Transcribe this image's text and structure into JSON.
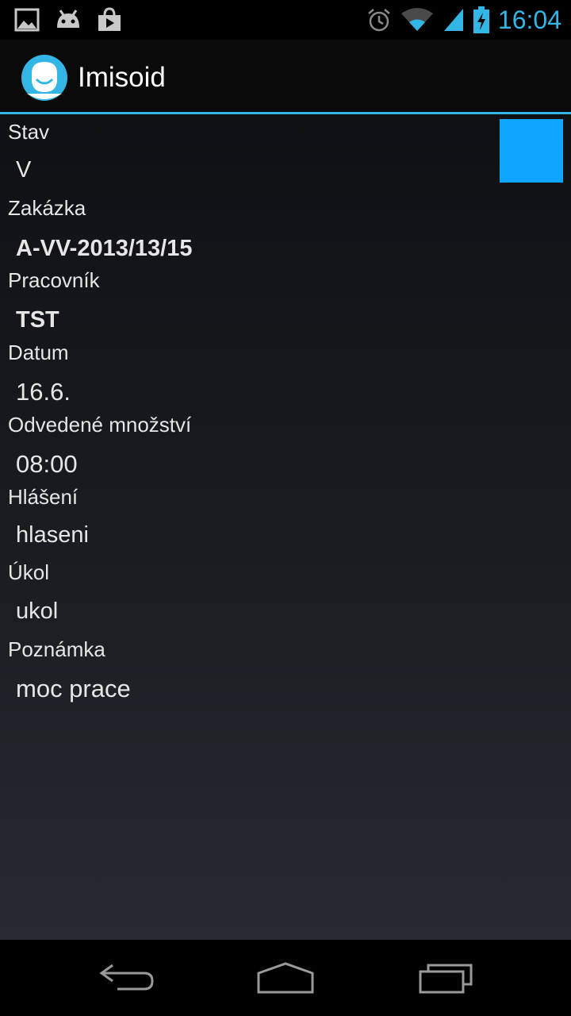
{
  "status_bar": {
    "time": "16:04",
    "left_icons": [
      "image-icon",
      "android-icon",
      "play-store-icon"
    ],
    "right_icons": [
      "alarm-icon",
      "wifi-icon",
      "signal-icon",
      "battery-charging-icon"
    ]
  },
  "action_bar": {
    "title": "Imisoid",
    "icon": "app-face-icon"
  },
  "status_color": "#0ea5ff",
  "accent": "#33b5e5",
  "fields": {
    "stav": {
      "label": "Stav",
      "value": "V"
    },
    "zakazka": {
      "label": "Zakázka",
      "value": "A-VV-2013/13/15"
    },
    "pracovnik": {
      "label": "Pracovník",
      "value": "TST"
    },
    "datum": {
      "label": "Datum",
      "value": "16.6."
    },
    "mnozstvi": {
      "label": "Odvedené množství",
      "value": "08:00"
    },
    "hlaseni": {
      "label": "Hlášení",
      "value": "hlaseni"
    },
    "ukol": {
      "label": "Úkol",
      "value": "ukol"
    },
    "poznamka": {
      "label": "Poznámka",
      "value": "moc prace"
    }
  },
  "nav_bar": [
    "back-icon",
    "home-icon",
    "recent-apps-icon"
  ]
}
